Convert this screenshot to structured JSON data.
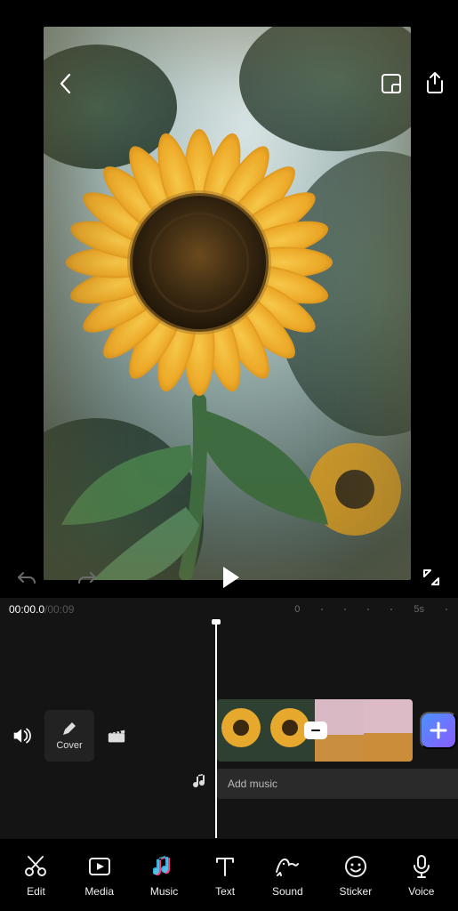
{
  "time": {
    "current": "00:00.0",
    "duration": "/00:09"
  },
  "ruler": {
    "zero": "0",
    "five": "5s"
  },
  "cover": {
    "label": "Cover"
  },
  "music_track": {
    "placeholder": "Add music"
  },
  "toolbar": {
    "edit": {
      "label": "Edit"
    },
    "media": {
      "label": "Media"
    },
    "music": {
      "label": "Music"
    },
    "text": {
      "label": "Text"
    },
    "sound": {
      "label": "Sound"
    },
    "sticker": {
      "label": "Sticker"
    },
    "voice": {
      "label": "Voice"
    }
  },
  "icons": {
    "back": "back-icon",
    "crop": "crop-icon",
    "share": "share-icon",
    "undo": "undo-icon",
    "redo": "redo-icon",
    "play": "play-icon",
    "expand": "expand-icon",
    "volume": "volume-icon",
    "pencil": "pencil-icon",
    "clapper": "clapper-icon",
    "note": "note-icon",
    "plus": "plus-icon",
    "minus": "minus-icon"
  },
  "colors": {
    "accent_gradient_from": "#4b91ff",
    "accent_gradient_to": "#8a5cff",
    "music_icon_pink": "#ff3b7a",
    "music_icon_cyan": "#39d6ff"
  }
}
